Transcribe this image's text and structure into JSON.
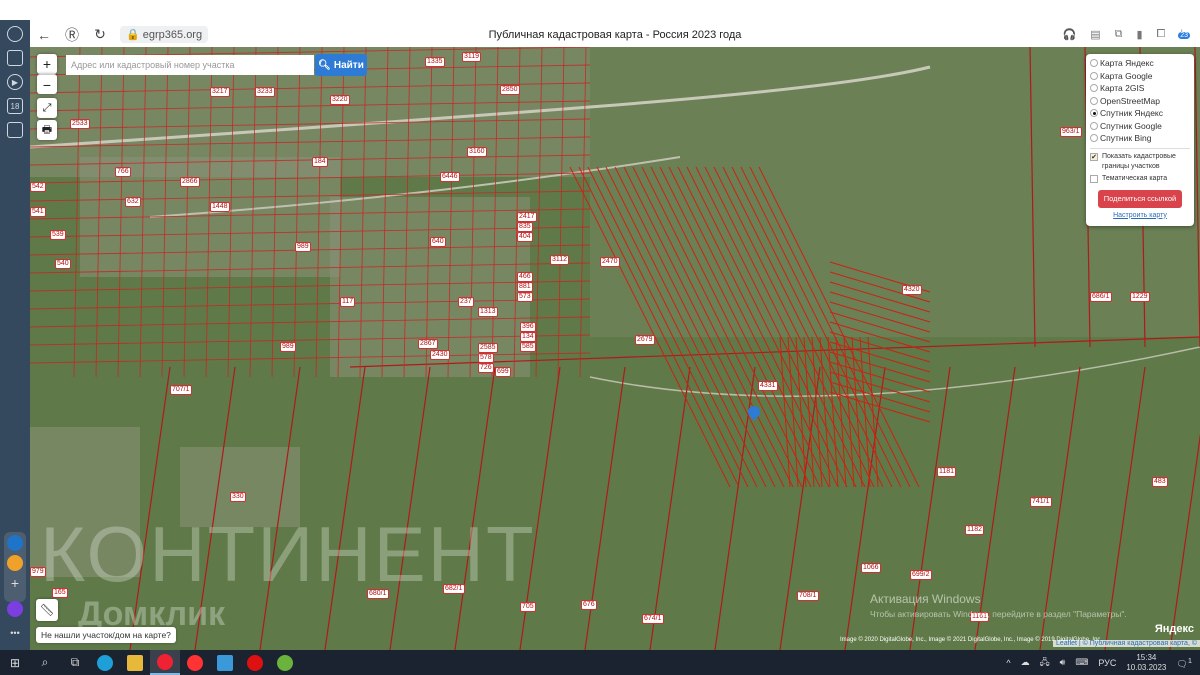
{
  "browser": {
    "url": "egrp365.org",
    "title": "Публичная кадастровая карта - Россия 2023 года",
    "downloads_badge": "23",
    "tabs_badge": "1"
  },
  "sidebar": {
    "items": [
      "history-icon",
      "collections-icon",
      "video-icon",
      "calendar-icon",
      "screenshot-icon"
    ],
    "calendar_day": "18"
  },
  "map": {
    "search_placeholder": "Адрес или кадастровый номер участка",
    "search_value": "",
    "find_label": "Найти",
    "zoom_in": "+",
    "zoom_out": "−",
    "layers": {
      "options": [
        {
          "label": "Карта Яндекс",
          "selected": false
        },
        {
          "label": "Карта Google",
          "selected": false
        },
        {
          "label": "Карта 2GIS",
          "selected": false
        },
        {
          "label": "OpenStreetMap",
          "selected": false
        },
        {
          "label": "Спутник Яндекс",
          "selected": true
        },
        {
          "label": "Спутник Google",
          "selected": false
        },
        {
          "label": "Спутник Bing",
          "selected": false
        }
      ],
      "show_borders": "Показать кадастровые границы участков",
      "show_borders_checked": true,
      "thematic": "Тематическая карта",
      "thematic_checked": false,
      "share": "Поделиться ссылкой",
      "configure": "Настроить карту"
    },
    "not_found": "Не нашли участок/дом на карте?",
    "parcel_labels": [
      "3217",
      "3233",
      "3220",
      "2533",
      "1335",
      "184",
      "3160",
      "2850",
      "3119",
      "2866",
      "1448",
      "6446",
      "640",
      "632",
      "542",
      "541",
      "539",
      "540",
      "766",
      "989",
      "3112",
      "2470",
      "2417",
      "835",
      "404",
      "466",
      "881",
      "573",
      "237",
      "1313",
      "396",
      "134",
      "585",
      "2679",
      "4331",
      "4320",
      "963/1",
      "686/1",
      "1229",
      "707/1",
      "989",
      "330",
      "979",
      "165",
      "680/1",
      "682/1",
      "705",
      "676",
      "674/1",
      "708/1",
      "1066",
      "699/2",
      "1181",
      "1182",
      "741/1",
      "483",
      "1161",
      "2585",
      "578",
      "726",
      "699",
      "2867",
      "2430",
      "117"
    ],
    "attribution": "Image © 2020 DigitalGlobe, Inc., Image © 2021 DigitalGlobe, Inc., Image © 2019 DigitalGlobe, Inc.",
    "leaflet": "Leaflet | © Публичная кадастровая карта, ©",
    "yandex_logo": "Яндекс",
    "watermark1": "КОНТИНЕНТ",
    "watermark2": "Домклик"
  },
  "activation": {
    "title": "Активация Windows",
    "text": "Чтобы активировать Windows, перейдите в раздел \"Параметры\"."
  },
  "taskbar": {
    "lang": "РУС",
    "time": "15:34",
    "date": "10.03.2023",
    "notif": "1"
  }
}
